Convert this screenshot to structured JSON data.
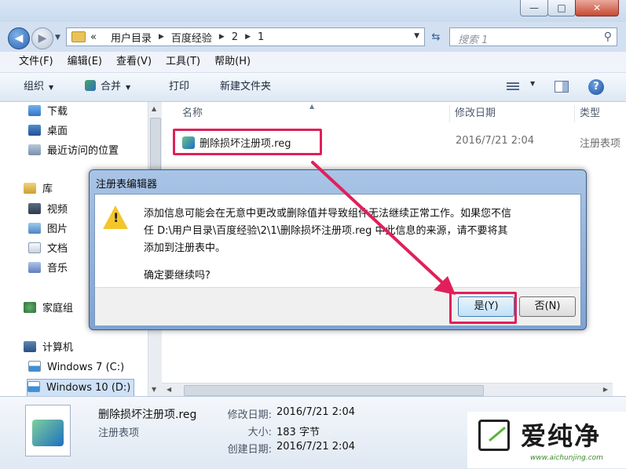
{
  "window": {
    "controls": {
      "minimize": "—",
      "maximize": "□",
      "close": "✕"
    }
  },
  "address": {
    "back_glyph": "◀",
    "forward_glyph": "▶",
    "prefix": "«",
    "crumbs": [
      "用户目录",
      "百度经验",
      "2",
      "1"
    ],
    "search_placeholder": "搜索 1"
  },
  "menu": [
    "文件(F)",
    "编辑(E)",
    "查看(V)",
    "工具(T)",
    "帮助(H)"
  ],
  "toolbar": {
    "organize": "组织",
    "merge": "合并",
    "print": "打印",
    "new_folder": "新建文件夹",
    "help": "?"
  },
  "nav": {
    "favorites": [
      "下载",
      "桌面",
      "最近访问的位置"
    ],
    "library_title": "库",
    "libraries": [
      "视频",
      "图片",
      "文档",
      "音乐"
    ],
    "homegroup": "家庭组",
    "computer_title": "计算机",
    "drives": [
      "Windows 7 (C:)",
      "Windows 10 (D:)"
    ]
  },
  "columns": {
    "name": "名称",
    "date": "修改日期",
    "type": "类型"
  },
  "files": [
    {
      "name": "删除损坏注册项.reg",
      "date": "2016/7/21 2:04",
      "type": "注册表项"
    }
  ],
  "details": {
    "name": "删除损坏注册项.reg",
    "type": "注册表项",
    "date_label": "修改日期:",
    "date_value": "2016/7/21 2:04",
    "size_label": "大小:",
    "size_value": "183 字节",
    "created_label": "创建日期:",
    "created_value": "2016/7/21 2:04"
  },
  "dialog": {
    "title": "注册表编辑器",
    "message": "添加信息可能会在无意中更改或删除值并导致组件无法继续正常工作。如果您不信\n任 D:\\用户目录\\百度经验\\2\\1\\删除损坏注册项.reg 中此信息的来源，请不要将其\n添加到注册表中。",
    "question": "确定要继续吗?",
    "yes": "是(Y)",
    "no": "否(N)"
  },
  "colors": {
    "highlight": "#e0205a",
    "accent": "#2a63b5"
  },
  "watermark": {
    "text": "爱纯净",
    "url": "www.aichunjing.com"
  }
}
